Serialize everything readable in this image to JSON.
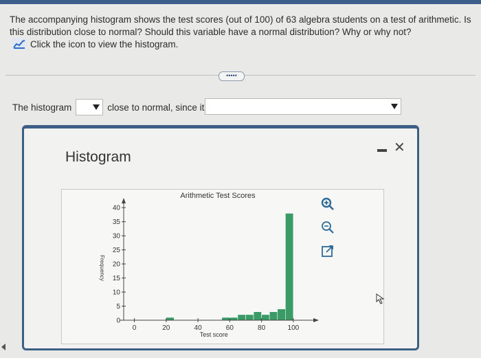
{
  "question": {
    "text": "The accompanying histogram shows the test scores (out of 100) of 63 algebra students on a test of arithmetic. Is this distribution close to normal? Should this variable have a normal distribution? Why or why not?",
    "view_link": "Click the icon to view the histogram."
  },
  "more_button": "•••••",
  "answer": {
    "prefix": "The histogram",
    "dropdown1_value": "",
    "middle": "close to normal, since it is",
    "dropdown2_value": ""
  },
  "modal": {
    "title": "Histogram",
    "minimize_symbol": "—",
    "close_symbol": "✕"
  },
  "icons": {
    "view": "bar-chart-icon",
    "zoom_in": "zoom-in-icon",
    "zoom_out": "zoom-out-icon",
    "popout": "external-link-icon"
  },
  "colors": {
    "bar": "#3a9b66",
    "modal_border": "#3d5f86"
  },
  "chart_data": {
    "type": "bar",
    "title": "Arithmetic Test Scores",
    "xlabel": "Test score",
    "ylabel": "Frequency",
    "xlim": [
      -5,
      110
    ],
    "ylim": [
      0,
      42
    ],
    "x_ticks": [
      0,
      20,
      40,
      60,
      80,
      100
    ],
    "y_ticks": [
      0,
      5,
      10,
      15,
      20,
      25,
      30,
      35,
      40
    ],
    "bin_width": 5,
    "bins": [
      {
        "x0": 20,
        "value": 1
      },
      {
        "x0": 25,
        "value": 0
      },
      {
        "x0": 30,
        "value": 0
      },
      {
        "x0": 35,
        "value": 0
      },
      {
        "x0": 40,
        "value": 0
      },
      {
        "x0": 45,
        "value": 0
      },
      {
        "x0": 50,
        "value": 0
      },
      {
        "x0": 55,
        "value": 1
      },
      {
        "x0": 60,
        "value": 1
      },
      {
        "x0": 65,
        "value": 2
      },
      {
        "x0": 70,
        "value": 2
      },
      {
        "x0": 75,
        "value": 3
      },
      {
        "x0": 80,
        "value": 2
      },
      {
        "x0": 85,
        "value": 3
      },
      {
        "x0": 90,
        "value": 4
      },
      {
        "x0": 95,
        "value": 38
      }
    ],
    "grid": false
  }
}
